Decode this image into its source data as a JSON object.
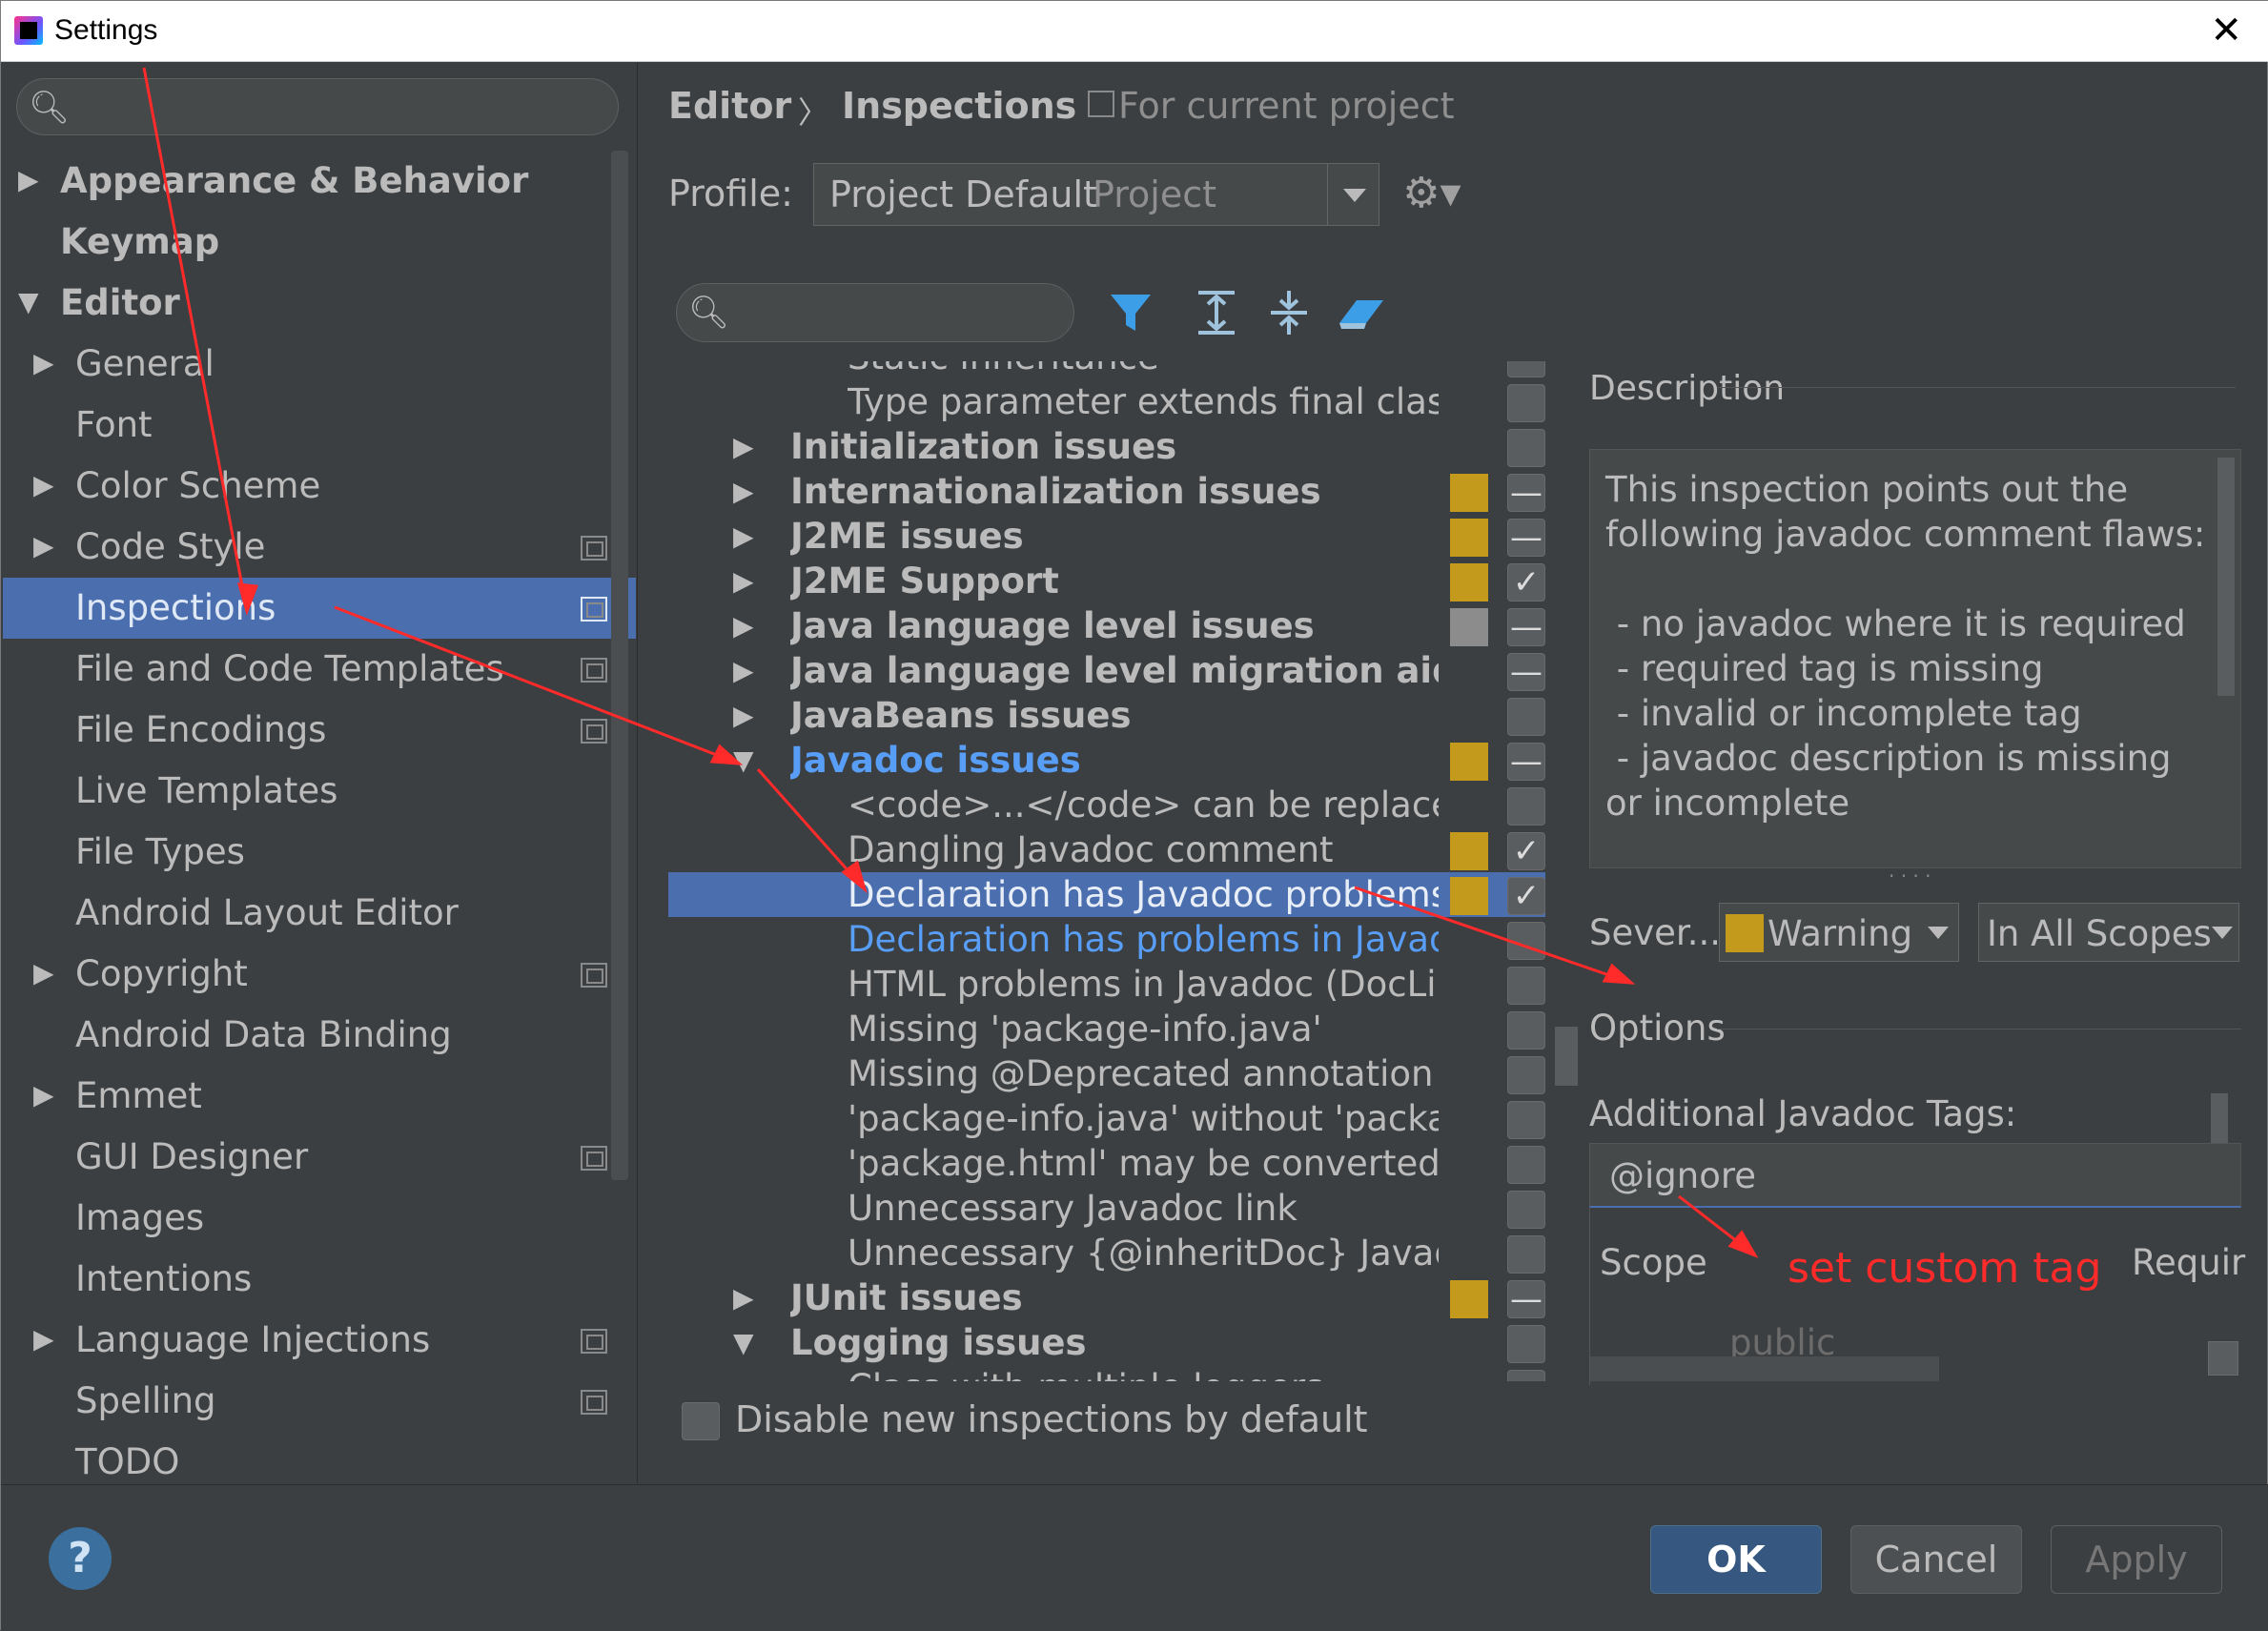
{
  "window": {
    "title": "Settings",
    "close": "✕"
  },
  "sidebar": {
    "items": [
      {
        "label": "Appearance & Behavior",
        "bold": true,
        "arrow": "▶"
      },
      {
        "label": "Keymap",
        "bold": true,
        "arrow": ""
      },
      {
        "label": "Editor",
        "bold": true,
        "arrow": "▼"
      },
      {
        "label": "General",
        "arrow": "▶"
      },
      {
        "label": "Font",
        "arrow": ""
      },
      {
        "label": "Color Scheme",
        "arrow": "▶"
      },
      {
        "label": "Code Style",
        "arrow": "▶",
        "project": true
      },
      {
        "label": "Inspections",
        "arrow": "",
        "project": true,
        "selected": true
      },
      {
        "label": "File and Code Templates",
        "arrow": "",
        "project": true
      },
      {
        "label": "File Encodings",
        "arrow": "",
        "project": true
      },
      {
        "label": "Live Templates",
        "arrow": ""
      },
      {
        "label": "File Types",
        "arrow": ""
      },
      {
        "label": "Android Layout Editor",
        "arrow": ""
      },
      {
        "label": "Copyright",
        "arrow": "▶",
        "project": true
      },
      {
        "label": "Android Data Binding",
        "arrow": ""
      },
      {
        "label": "Emmet",
        "arrow": "▶"
      },
      {
        "label": "GUI Designer",
        "arrow": "",
        "project": true
      },
      {
        "label": "Images",
        "arrow": ""
      },
      {
        "label": "Intentions",
        "arrow": ""
      },
      {
        "label": "Language Injections",
        "arrow": "▶",
        "project": true
      },
      {
        "label": "Spelling",
        "arrow": "",
        "project": true
      },
      {
        "label": "TODO",
        "arrow": ""
      }
    ]
  },
  "breadcrumb": {
    "editor": "Editor",
    "sep": "〉",
    "inspections": "Inspections",
    "scope": "For current project"
  },
  "profile": {
    "label": "Profile:",
    "value": "Project Default",
    "hint": "Project"
  },
  "toolbar": {
    "filter_icon": "filter-icon",
    "expand_icon": "expand-all-icon",
    "collapse_icon": "collapse-all-icon",
    "reset_icon": "eraser-icon"
  },
  "inspections": [
    {
      "label": "Static inheritance",
      "level": 2,
      "cut": true
    },
    {
      "label": "Type parameter extends final class",
      "level": 2,
      "sev": "",
      "cb": ""
    },
    {
      "label": "Initialization issues",
      "level": 1,
      "bold": true,
      "arrow": "▶",
      "sev": "",
      "cb": ""
    },
    {
      "label": "Internationalization issues",
      "level": 1,
      "bold": true,
      "arrow": "▶",
      "sev": "#c49a1d",
      "cb": "—"
    },
    {
      "label": "J2ME issues",
      "level": 1,
      "bold": true,
      "arrow": "▶",
      "sev": "#c49a1d",
      "cb": "—"
    },
    {
      "label": "J2ME Support",
      "level": 1,
      "bold": true,
      "arrow": "▶",
      "sev": "#c49a1d",
      "cb": "✓"
    },
    {
      "label": "Java language level issues",
      "level": 1,
      "bold": true,
      "arrow": "▶",
      "sev": "#8c8c8c",
      "cb": "—"
    },
    {
      "label": "Java language level migration aids",
      "level": 1,
      "bold": true,
      "arrow": "▶",
      "sev": "",
      "cb": "—"
    },
    {
      "label": "JavaBeans issues",
      "level": 1,
      "bold": true,
      "arrow": "▶",
      "sev": "",
      "cb": ""
    },
    {
      "label": "Javadoc issues",
      "level": 1,
      "bold": true,
      "blue": true,
      "arrow": "▼",
      "sev": "#c49a1d",
      "cb": "—"
    },
    {
      "label": "<code>...</code> can be replaced w",
      "level": 2,
      "sev": "",
      "cb": ""
    },
    {
      "label": "Dangling Javadoc comment",
      "level": 2,
      "sev": "#c49a1d",
      "cb": "✓"
    },
    {
      "label": "Declaration has Javadoc problems",
      "level": 2,
      "selected": true,
      "sev": "#c49a1d",
      "cb": "✓"
    },
    {
      "label": "Declaration has problems in Javadoc",
      "level": 2,
      "blue": true,
      "sev": "",
      "cb": ""
    },
    {
      "label": "HTML problems in Javadoc (DocLint",
      "level": 2,
      "sev": "",
      "cb": ""
    },
    {
      "label": "Missing 'package-info.java'",
      "level": 2,
      "sev": "",
      "cb": ""
    },
    {
      "label": "Missing @Deprecated annotation",
      "level": 2,
      "sev": "",
      "cb": ""
    },
    {
      "label": "'package-info.java' without 'package",
      "level": 2,
      "sev": "",
      "cb": ""
    },
    {
      "label": "'package.html' may be converted to",
      "level": 2,
      "sev": "",
      "cb": ""
    },
    {
      "label": "Unnecessary Javadoc link",
      "level": 2,
      "sev": "",
      "cb": ""
    },
    {
      "label": "Unnecessary {@inheritDoc} Javadoc",
      "level": 2,
      "sev": "",
      "cb": ""
    },
    {
      "label": "JUnit issues",
      "level": 1,
      "bold": true,
      "arrow": "▶",
      "sev": "#c49a1d",
      "cb": "—"
    },
    {
      "label": "Logging issues",
      "level": 1,
      "bold": true,
      "arrow": "▼",
      "sev": "",
      "cb": ""
    },
    {
      "label": "Class with multiple loggers",
      "level": 2,
      "cut": true
    }
  ],
  "description": {
    "title": "Description",
    "text": "This inspection points out the\nfollowing javadoc comment flaws:\n\n - no javadoc where it is required\n - required tag is missing\n - invalid or incomplete tag\n - javadoc description is missing\nor incomplete"
  },
  "severity": {
    "label": "Sever...",
    "value": "Warning",
    "color": "#c49a1d",
    "scope": "In All Scopes"
  },
  "options": {
    "title": "Options",
    "additional_tags_label": "Additional Javadoc Tags:",
    "additional_tags_value": "@ignore",
    "scope_header": "Scope",
    "required_header": "Requir",
    "scope_value": "public"
  },
  "annotation": {
    "note": "set custom tag",
    "color": "#ff2a2a"
  },
  "footer": {
    "disable_label": "Disable new inspections by default",
    "help": "?",
    "ok": "OK",
    "cancel": "Cancel",
    "apply": "Apply"
  }
}
